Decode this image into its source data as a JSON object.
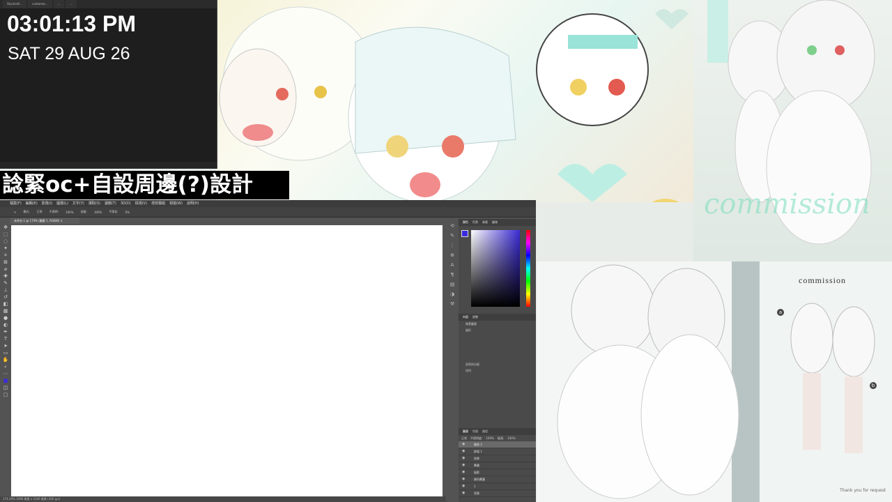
{
  "clock": {
    "time": "03:01:13 PM",
    "date": "SAT 29 AUG 26",
    "tabs": [
      "Stockmill...",
      "container...",
      "...",
      "..."
    ]
  },
  "banner": {
    "title": "諗緊oc+自設周邊(?)設計"
  },
  "photoshop": {
    "menus": [
      "檔案(F)",
      "編輯(E)",
      "影像(I)",
      "圖層(L)",
      "文字(Y)",
      "選取(S)",
      "濾鏡(T)",
      "3D(D)",
      "檢視(V)",
      "增效模組",
      "視窗(W)",
      "說明(H)"
    ],
    "options": [
      "模式:",
      "正常",
      "不透明:",
      "100%",
      "流量:",
      "100%",
      "平滑化:",
      "0%"
    ],
    "document_tab": "未命名-1 @ 174% (圖層 1, RGB/8) ×",
    "status": "174.39% 3496 像素 x 3346 像素 (300 ppi)",
    "panels": {
      "color_tabs": [
        "顏色",
        "色票",
        "漸層",
        "圖樣"
      ],
      "props_tabs": [
        "內容",
        "調整"
      ],
      "props_title": "像素圖層",
      "props_sections": [
        "變形",
        "對齊與分配",
        "排列"
      ],
      "layers_tabs": [
        "圖層",
        "色版",
        "路徑"
      ],
      "blend_mode": "正常",
      "opacity_label": "不透明度:",
      "opacity_value": "100%",
      "fill_label": "填滿:",
      "fill_value": "100%",
      "layers": [
        {
          "name": "圖層 2",
          "selected": true
        },
        {
          "name": "群組 1",
          "selected": false
        },
        {
          "name": "效果",
          "selected": false
        },
        {
          "name": "筆畫",
          "selected": false
        },
        {
          "name": "陰影",
          "selected": false
        },
        {
          "name": "顏色覆蓋",
          "selected": false
        },
        {
          "name": "1",
          "selected": false
        },
        {
          "name": "背景",
          "selected": false
        }
      ],
      "fg_color": "#3a2be0"
    }
  },
  "art": {
    "commission_word": "commission",
    "commission_script": "commission",
    "thanks": "Thank you for request",
    "label_a": "a",
    "label_b": "b"
  }
}
